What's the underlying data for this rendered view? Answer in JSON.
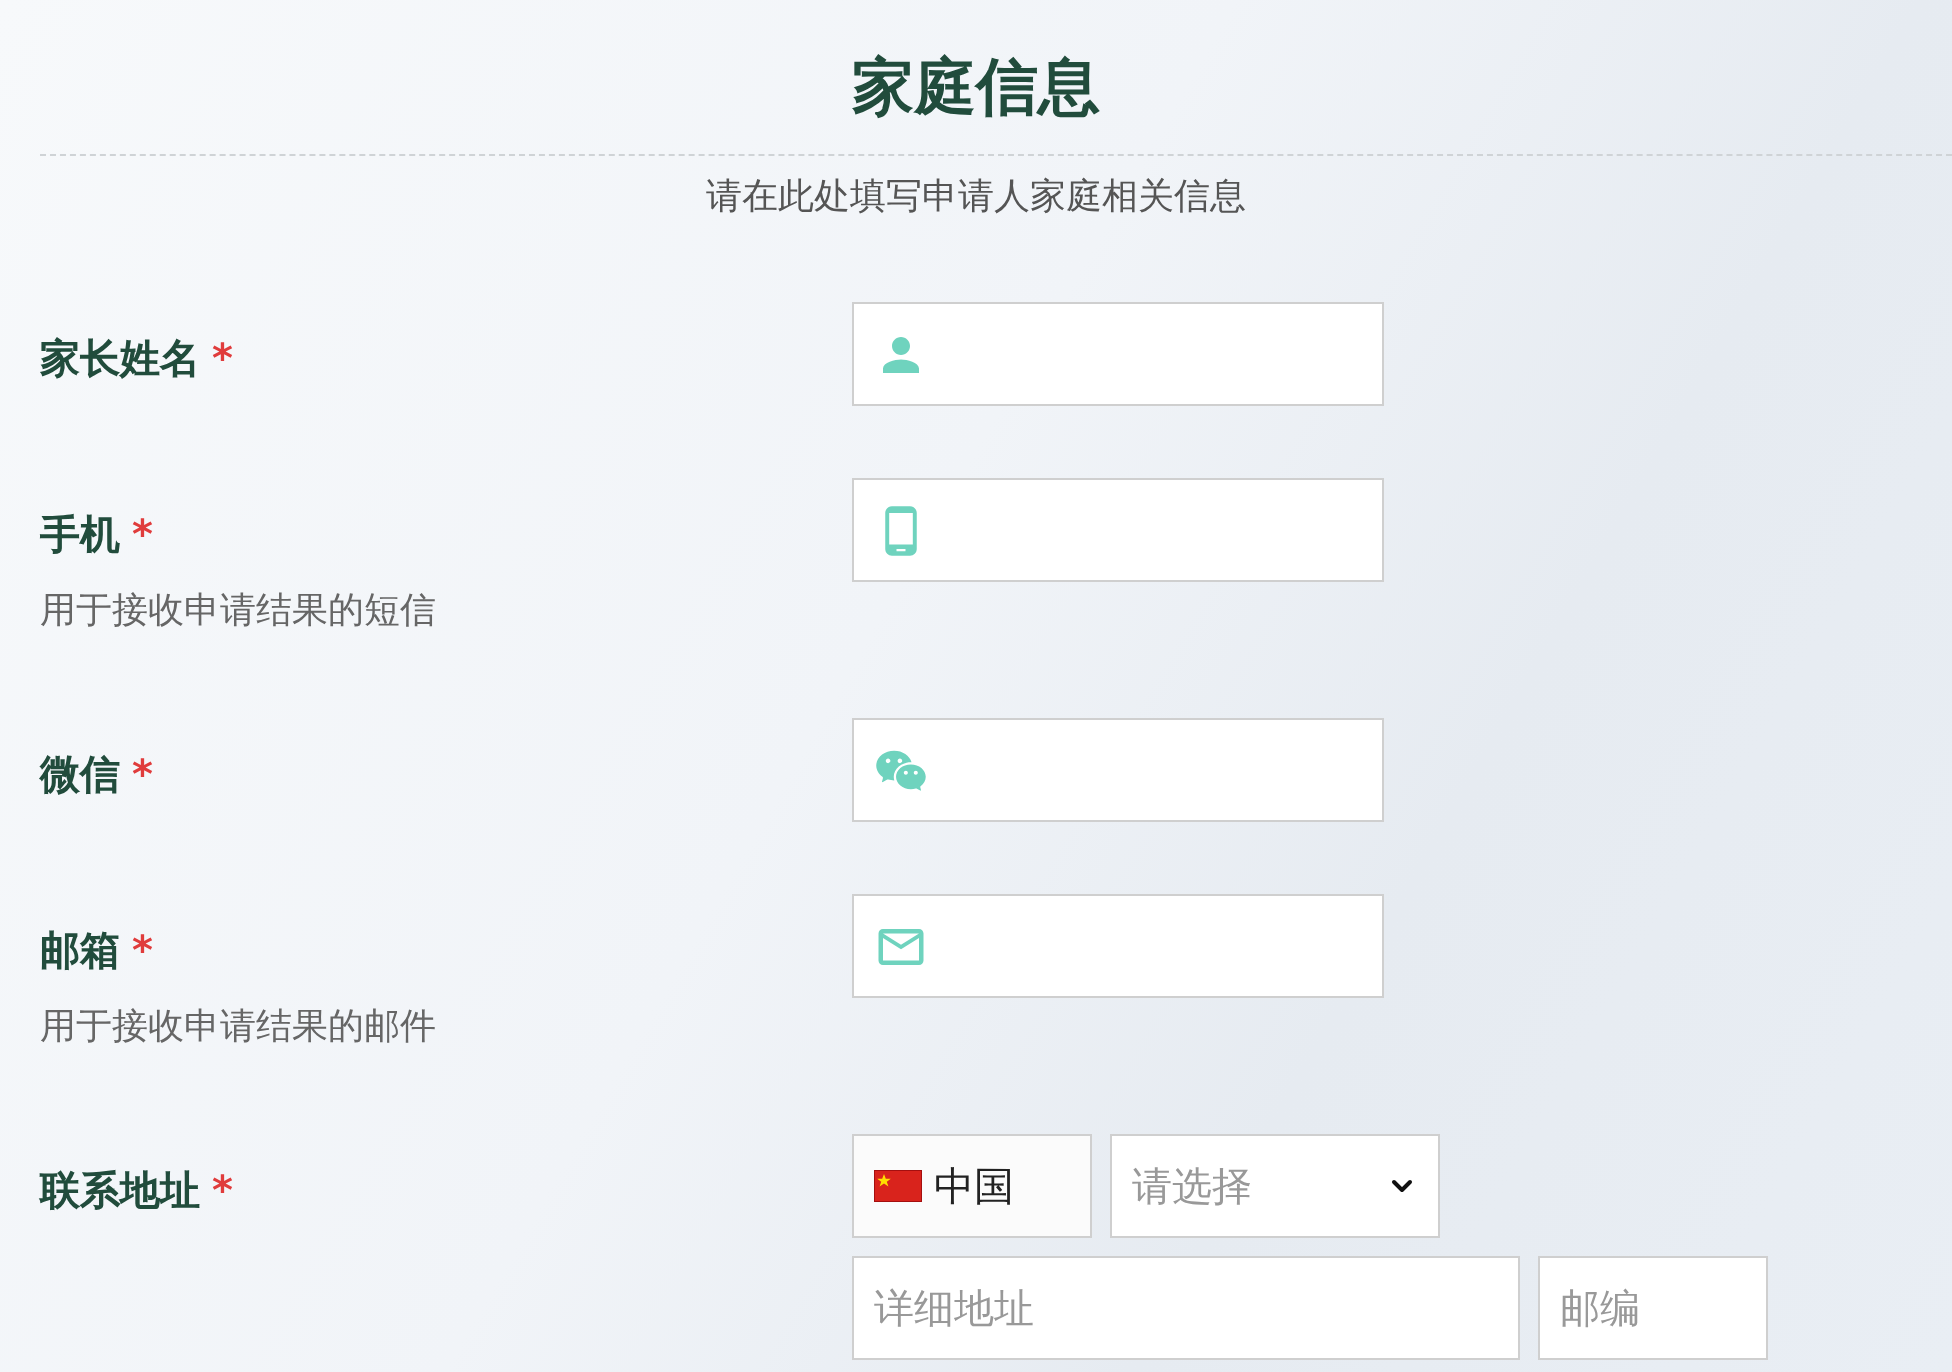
{
  "title": "家庭信息",
  "subtitle": "请在此处填写申请人家庭相关信息",
  "required_mark": "*",
  "fields": [
    {
      "kind": "name",
      "label": "家长姓名",
      "required": true
    },
    {
      "kind": "phone",
      "label": "手机",
      "required": true,
      "hint": "用于接收申请结果的短信"
    },
    {
      "kind": "wechat",
      "label": "微信",
      "required": true
    },
    {
      "kind": "email",
      "label": "邮箱",
      "required": true,
      "hint": "用于接收申请结果的邮件"
    },
    {
      "kind": "address",
      "label": "联系地址",
      "required": true,
      "country": "中国",
      "region_placeholder": "请选择",
      "detail_placeholder": "详细地址",
      "postcode_placeholder": "邮编"
    }
  ]
}
